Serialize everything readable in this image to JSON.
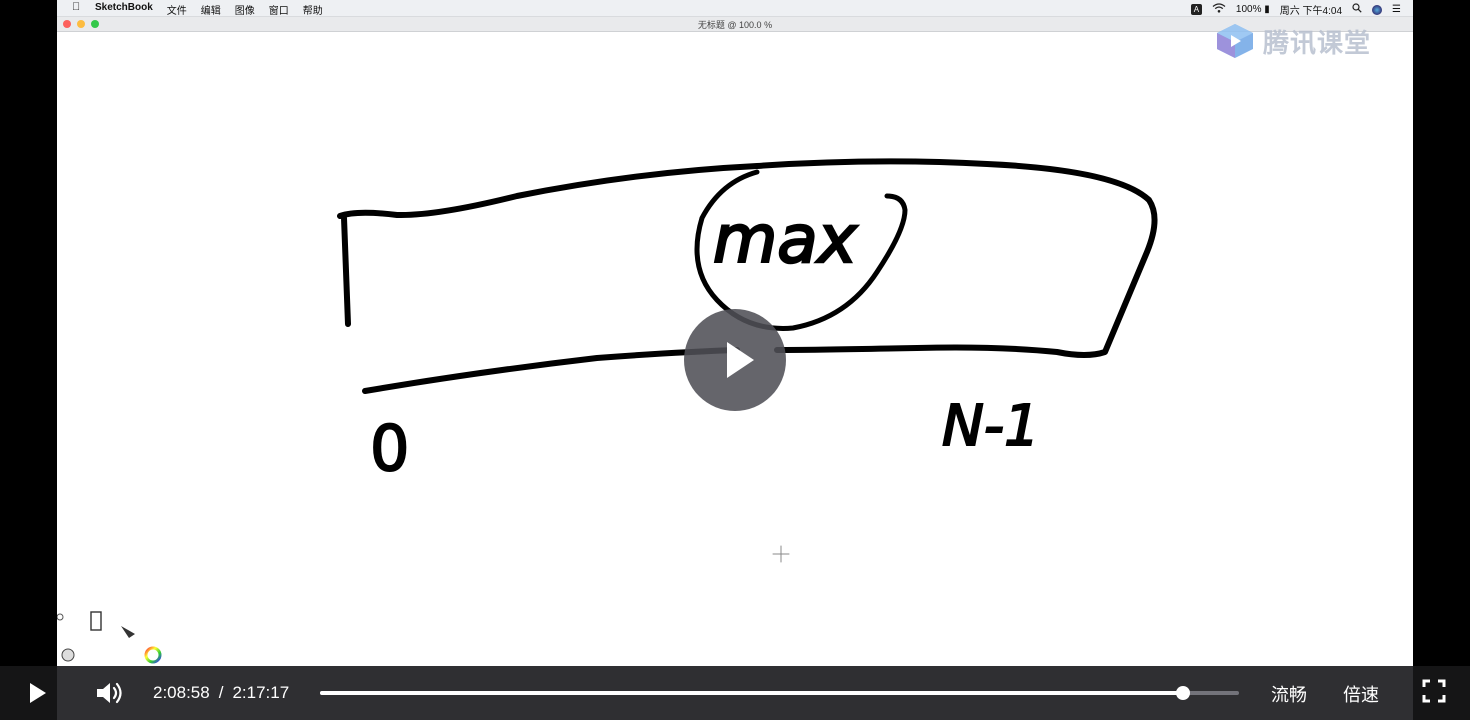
{
  "menubar": {
    "app_name": "SketchBook",
    "menus": [
      "文件",
      "编辑",
      "图像",
      "窗口",
      "帮助"
    ],
    "battery": "100%",
    "clock": "周六 下午4:04"
  },
  "window": {
    "title": "无标题 @ 100.0 %"
  },
  "watermark": {
    "text": "腾讯课堂"
  },
  "sketch": {
    "labels": {
      "max": "max",
      "zero": "0",
      "n_minus_1": "N-1"
    }
  },
  "player": {
    "current_time": "2:08:58",
    "separator": "/",
    "duration": "2:17:17",
    "progress": 0.939,
    "quality_label": "流畅",
    "speed_label": "倍速"
  },
  "colors": {
    "controls_bg": "#3c3c40",
    "play_overlay": "#505056",
    "watermark": "#b8c0cf"
  }
}
